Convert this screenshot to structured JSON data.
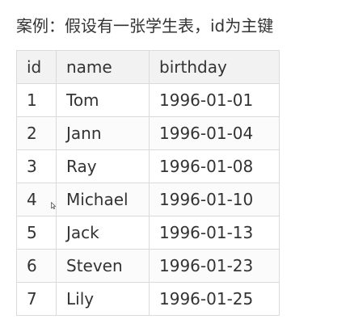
{
  "heading": "案例：假设有一张学生表，id为主键",
  "table": {
    "columns": [
      "id",
      "name",
      "birthday"
    ],
    "rows": [
      [
        "1",
        "Tom",
        "1996-01-01"
      ],
      [
        "2",
        "Jann",
        "1996-01-04"
      ],
      [
        "3",
        "Ray",
        "1996-01-08"
      ],
      [
        "4",
        "Michael",
        "1996-01-10"
      ],
      [
        "5",
        "Jack",
        "1996-01-13"
      ],
      [
        "6",
        "Steven",
        "1996-01-23"
      ],
      [
        "7",
        "Lily",
        "1996-01-25"
      ]
    ]
  },
  "cursor_icon": "mouse-pointer-icon"
}
